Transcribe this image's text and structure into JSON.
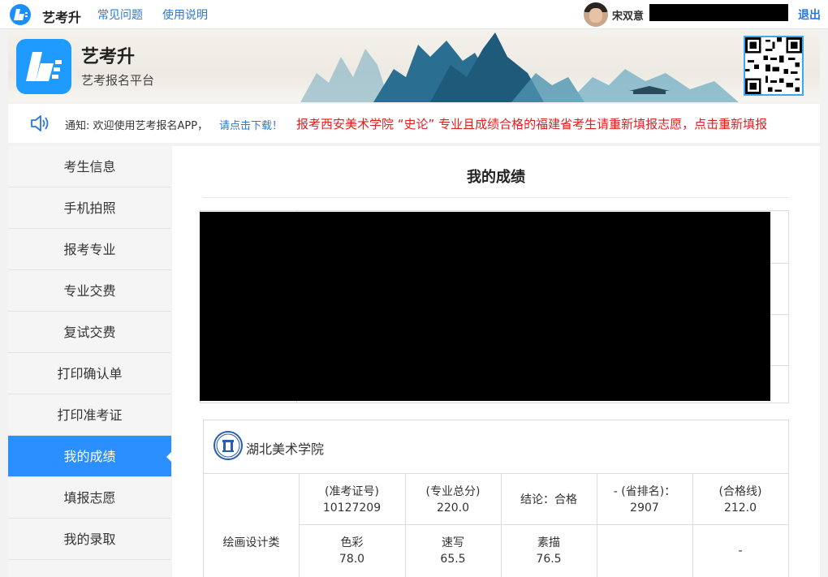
{
  "topbar": {
    "brand": "艺考升",
    "links": [
      "常见问题",
      "使用说明"
    ],
    "username": "宋双意",
    "logout": "退出"
  },
  "banner": {
    "title": "艺考升",
    "subtitle": "艺考报名平台"
  },
  "notice": {
    "label": "通知: 欢迎使用艺考报名APP，",
    "link": "请点击下载！",
    "message": "报考西安美术学院 “史论” 专业且成绩合格的福建省考生请重新填报志愿，点击重新填报"
  },
  "sidebar": {
    "items": [
      {
        "label": "考生信息"
      },
      {
        "label": "手机拍照"
      },
      {
        "label": "报考专业"
      },
      {
        "label": "专业交费"
      },
      {
        "label": "复试交费"
      },
      {
        "label": "打印确认单"
      },
      {
        "label": "打印准考证"
      },
      {
        "label": "我的成绩",
        "active": true
      },
      {
        "label": "填报志愿"
      },
      {
        "label": "我的录取"
      }
    ]
  },
  "main": {
    "title": "我的成绩",
    "school": {
      "name": "湖北美术学院",
      "category": "绘画设计类",
      "row1": [
        {
          "label": "(准考证号)",
          "value": "10127209"
        },
        {
          "label": "(专业总分)",
          "value": "220.0"
        },
        {
          "label": "结论：合格",
          "value": ""
        },
        {
          "label": "- (省排名)：",
          "value": "2907"
        },
        {
          "label": "(合格线)",
          "value": "212.0"
        }
      ],
      "row2": [
        {
          "label": "色彩",
          "value": "78.0"
        },
        {
          "label": "速写",
          "value": "65.5"
        },
        {
          "label": "素描",
          "value": "76.5"
        },
        {
          "label": "",
          "value": ""
        },
        {
          "label": "",
          "value": "-"
        }
      ]
    }
  },
  "colors": {
    "accent": "#2b8fff",
    "link": "#2b78d8",
    "alert": "#e02020"
  }
}
